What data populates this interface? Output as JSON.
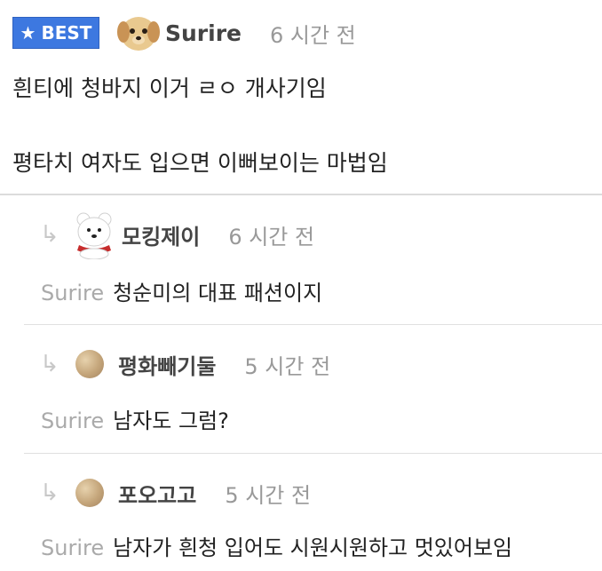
{
  "main_comment": {
    "badge": "BEST",
    "badge_icon": "star-icon",
    "author": "Surire",
    "time": "6 시간 전",
    "line1": "흰티에 청바지 이거 ㄹㅇ 개사기임",
    "line2": "평타치 여자도 입으면 이뻐보이는 마법임"
  },
  "replies": [
    {
      "author": "모킹제이",
      "time": "6 시간 전",
      "mention": "Surire",
      "text": "청순미의 대표 패션이지",
      "avatar": "polar-bear"
    },
    {
      "author": "평화빼기둘",
      "time": "5 시간 전",
      "mention": "Surire",
      "text": "남자도 그럼?",
      "avatar": "tan-ball"
    },
    {
      "author": "포오고고",
      "time": "5 시간 전",
      "mention": "Surire",
      "text": "남자가 흰청 입어도 시원시원하고 멋있어보임",
      "avatar": "tan-ball"
    }
  ],
  "icons": {
    "reply_arrow": "↳"
  },
  "colors": {
    "badge": "#3d78e0",
    "author": "#444444",
    "time": "#999999",
    "mention": "#aaaaaa"
  }
}
